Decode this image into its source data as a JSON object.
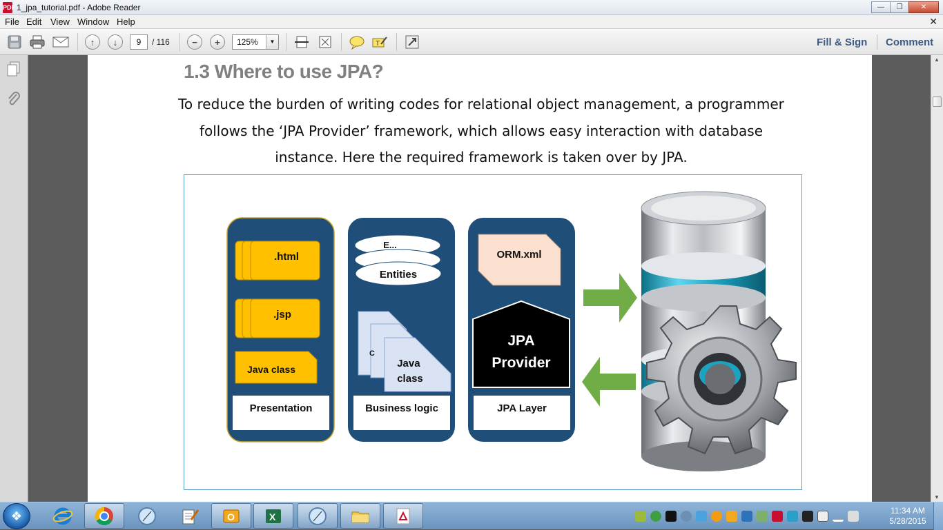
{
  "window": {
    "title": "1_jpa_tutorial.pdf - Adobe Reader",
    "app_icon": "PDF"
  },
  "menu": [
    "File",
    "Edit",
    "View",
    "Window",
    "Help"
  ],
  "toolbar": {
    "page_current": "9",
    "page_total": "/ 116",
    "zoom": "125%",
    "fill_sign_label": "Fill & Sign",
    "comment_label": "Comment"
  },
  "document": {
    "heading": "1.3 Where to use JPA?",
    "paragraph": "To reduce the burden of writing codes for relational object management, a programmer follows the ‘JPA Provider’ framework, which allows easy interaction with database instance. Here the required framework is taken over by JPA."
  },
  "diagram": {
    "presentation": {
      "html": ".html",
      "jsp": ".jsp",
      "java_class": "Java class",
      "label": "Presentation"
    },
    "business": {
      "entities": "Entities",
      "java_class": "Java class",
      "label": "Business logic",
      "back_hint_1": "E...",
      "back_hint_2": "C"
    },
    "jpa": {
      "orm": "ORM.xml",
      "provider_1": "JPA",
      "provider_2": "Provider",
      "label": "JPA Layer"
    },
    "colors": {
      "panel": "#1f4e79",
      "yellow": "#ffc000",
      "arrow": "#70ad47",
      "orm_fill": "#fbe0cf",
      "doc_fill": "#dae3f3"
    }
  },
  "taskbar": {
    "clock_time": "11:34 AM",
    "clock_date": "5/28/2015"
  }
}
